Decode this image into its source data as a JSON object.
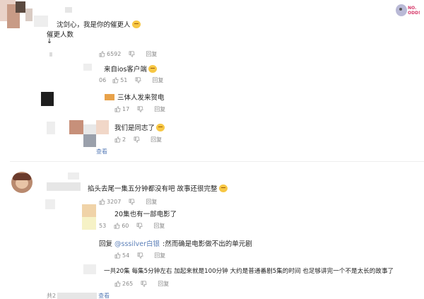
{
  "watermark": {
    "text": "NO. ODD!"
  },
  "comments": [
    {
      "id": "c1",
      "text": "沈剑心，我是你的催更人",
      "line2": "催更人数",
      "line3": "↓",
      "likes": "6592",
      "reply_label": "回复"
    },
    {
      "id": "c1r1",
      "text": "来自ios客户端",
      "time": "06",
      "likes": "51",
      "reply_label": "回复"
    },
    {
      "id": "c1r2",
      "text": "三体人发来贺电",
      "likes": "17",
      "reply_label": "回复"
    },
    {
      "id": "c1r3",
      "text": "我们是同志了",
      "likes": "2",
      "reply_label": "回复",
      "more": "查看"
    },
    {
      "id": "c2",
      "text": "掐头去尾一集五分钟都没有吧  故事还很完整",
      "likes": "3207",
      "reply_label": "回复"
    },
    {
      "id": "c2r1",
      "text": "20集也有一部电影了",
      "time": "53",
      "likes": "60",
      "reply_label": "回复"
    },
    {
      "id": "c2r2",
      "prefix": "回复",
      "mention": "@sssilver白银",
      "text": ":然而确是电影做不出的单元剧",
      "likes": "54",
      "reply_label": "回复"
    },
    {
      "id": "c2r3",
      "text": "一共20集 每集5分钟左右 加起来就是100分钟  大约是普通番剧5集的时间  也足够讲完一个不是太长的故事了",
      "likes": "265",
      "reply_label": "回复",
      "footer_prefix": "共2",
      "more": "查看"
    }
  ]
}
